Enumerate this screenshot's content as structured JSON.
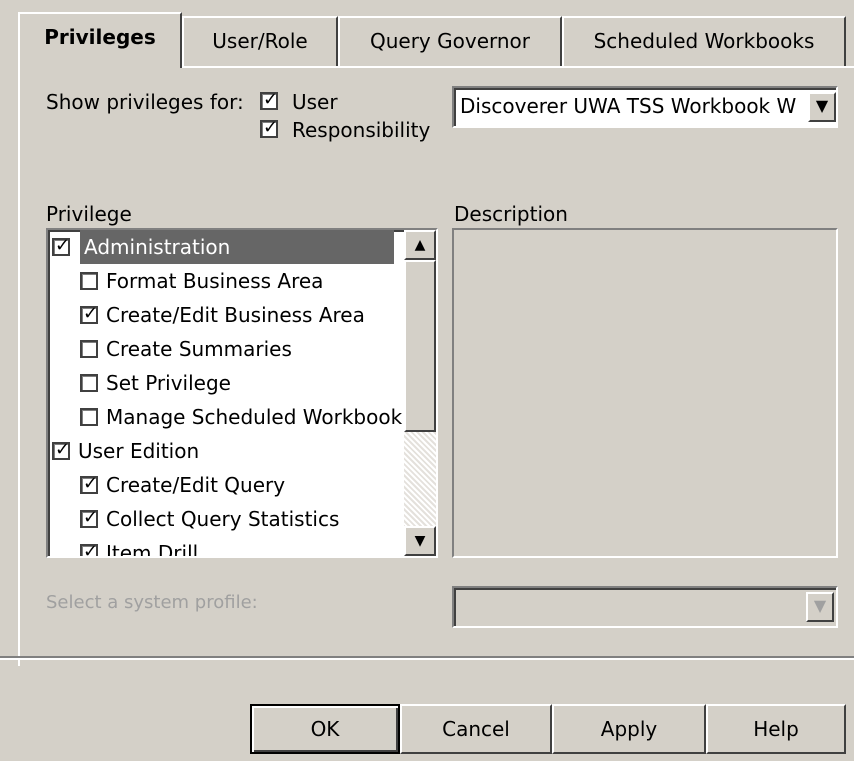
{
  "tabs": [
    {
      "label": "Privileges",
      "active": true
    },
    {
      "label": "User/Role"
    },
    {
      "label": "Query Governor"
    },
    {
      "label": "Scheduled Workbooks"
    }
  ],
  "show_for": {
    "label": "Show privileges for:",
    "user_label": "User",
    "responsibility_label": "Responsibility",
    "user_checked": true,
    "responsibility_checked": true
  },
  "selector_value": "Discoverer UWA TSS Workbook W",
  "privilege_label": "Privilege",
  "description_label": "Description",
  "privileges": [
    {
      "label": "Administration",
      "checked": true,
      "level": 0,
      "selected": true
    },
    {
      "label": "Format Business Area",
      "checked": false,
      "level": 1
    },
    {
      "label": "Create/Edit Business Area",
      "checked": true,
      "level": 1
    },
    {
      "label": "Create Summaries",
      "checked": false,
      "level": 1
    },
    {
      "label": "Set Privilege",
      "checked": false,
      "level": 1
    },
    {
      "label": "Manage Scheduled Workbook",
      "checked": false,
      "level": 1
    },
    {
      "label": "User Edition",
      "checked": true,
      "level": 0
    },
    {
      "label": "Create/Edit Query",
      "checked": true,
      "level": 1
    },
    {
      "label": "Collect Query Statistics",
      "checked": true,
      "level": 1
    },
    {
      "label": "Item Drill",
      "checked": true,
      "level": 1
    }
  ],
  "system_profile_label": "Select a system profile:",
  "buttons": {
    "ok": "OK",
    "cancel": "Cancel",
    "apply": "Apply",
    "help": "Help"
  },
  "colors": {
    "selection": "#666666",
    "face": "#d4d0c8",
    "disabled_text": "#a0a0a0"
  }
}
